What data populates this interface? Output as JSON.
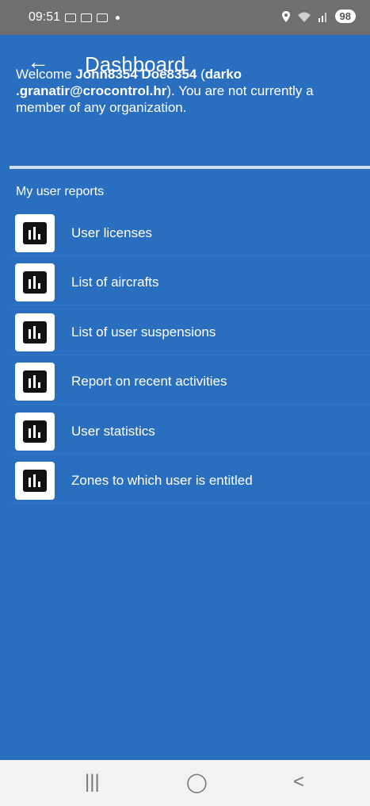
{
  "status_bar": {
    "time": "09:51",
    "battery": "98"
  },
  "app_bar": {
    "title": "Dashboard"
  },
  "welcome": {
    "prefix": "Welcome ",
    "user_name": "John8354 Doe8354",
    "open_paren": " (",
    "email": "darko .granatir@crocontrol.hr",
    "suffix": "). You are not currently a member of any organization."
  },
  "reports": {
    "section_label": "My user reports",
    "items": [
      {
        "label": "User licenses"
      },
      {
        "label": "List of aircrafts"
      },
      {
        "label": "List of user suspensions"
      },
      {
        "label": "Report on recent activities"
      },
      {
        "label": "User statistics"
      },
      {
        "label": "Zones to which user is entitled"
      }
    ]
  },
  "nav_bar": {
    "recents": "|||",
    "home": "◯",
    "back": "<"
  },
  "colors": {
    "primary": "#2a6ebf",
    "status_bar": "#6f6f6f",
    "nav_bar": "#f2f2f2"
  }
}
